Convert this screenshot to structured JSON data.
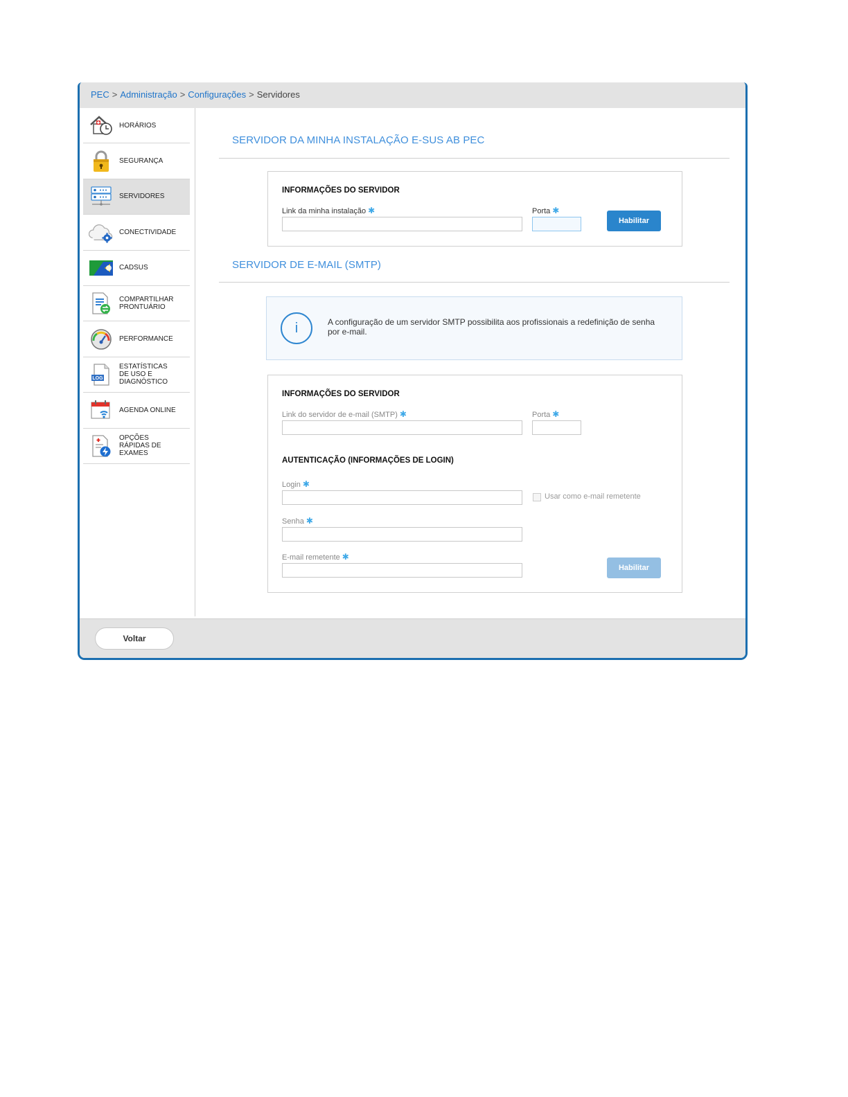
{
  "breadcrumb": {
    "items": [
      "PEC",
      "Administração",
      "Configurações"
    ],
    "current": "Servidores",
    "separator": ">"
  },
  "sidebar": {
    "items": [
      {
        "label": "HORÁRIOS",
        "icon": "house-clock-icon"
      },
      {
        "label": "SEGURANÇA",
        "icon": "padlock-icon"
      },
      {
        "label": "SERVIDORES",
        "icon": "server-icon",
        "active": true
      },
      {
        "label": "CONECTIVIDADE",
        "icon": "cloud-gear-icon"
      },
      {
        "label": "CADSUS",
        "icon": "flag-icon"
      },
      {
        "label": "COMPARTILHAR PRONTUÁRIO",
        "icon": "document-share-icon"
      },
      {
        "label": "PERFORMANCE",
        "icon": "gauge-icon"
      },
      {
        "label": "ESTATÍSTICAS DE USO E DIAGNÓSTICO",
        "icon": "log-file-icon"
      },
      {
        "label": "AGENDA ONLINE",
        "icon": "calendar-wifi-icon"
      },
      {
        "label": "OPÇÕES RÁPIDAS DE EXAMES",
        "icon": "exam-lightning-icon"
      }
    ]
  },
  "section1": {
    "title": "SERVIDOR DA MINHA INSTALAÇÃO E-SUS AB PEC",
    "box_title": "INFORMAÇÕES DO SERVIDOR",
    "link_label": "Link da minha instalação",
    "port_label": "Porta",
    "link_value": "",
    "port_value": "",
    "button": "Habilitar"
  },
  "section2": {
    "title": "SERVIDOR DE E-MAIL (SMTP)",
    "info_text": "A configuração de um servidor SMTP possibilita aos profissionais a redefinição de senha por e-mail.",
    "box_title": "INFORMAÇÕES DO SERVIDOR",
    "link_label": "Link do servidor de e-mail (SMTP)",
    "port_label": "Porta",
    "auth_title": "AUTENTICAÇÃO (INFORMAÇÕES DE LOGIN)",
    "login_label": "Login",
    "checkbox_label": "Usar como e-mail remetente",
    "password_label": "Senha",
    "sender_label": "E-mail remetente",
    "button": "Habilitar"
  },
  "required_marker": "✱",
  "footer": {
    "back": "Voltar"
  },
  "colors": {
    "accent": "#2a85cc",
    "frame_border": "#1c6fb0",
    "section_title": "#3f8fdc"
  }
}
